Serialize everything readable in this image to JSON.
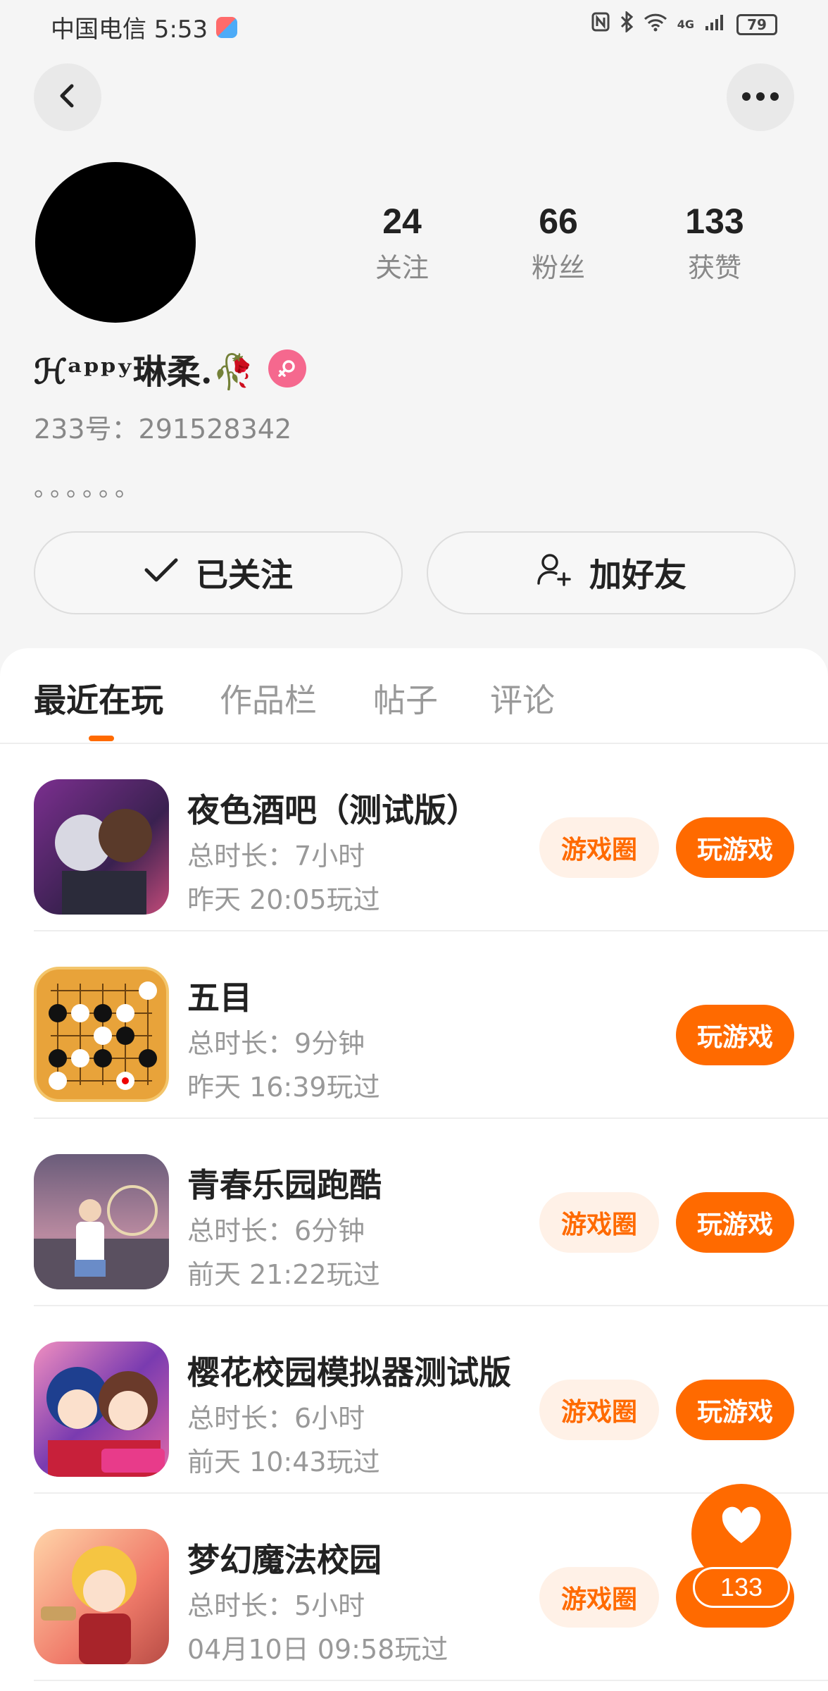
{
  "status_bar": {
    "carrier_time": "中国电信 5:53",
    "network": "4G",
    "battery": "79"
  },
  "profile": {
    "stats": [
      {
        "value": "24",
        "label": "关注"
      },
      {
        "value": "66",
        "label": "粉丝"
      },
      {
        "value": "133",
        "label": "获赞"
      }
    ],
    "nickname": "ℋᵃᵖᵖʸ琳柔.🥀",
    "id_line": "233号：291528342",
    "bio": "。。。。。。",
    "follow_button": "已关注",
    "add_friend_button": "加好友"
  },
  "tabs": [
    "最近在玩",
    "作品栏",
    "帖子",
    "评论"
  ],
  "active_tab": 0,
  "games": [
    {
      "title": "夜色酒吧（测试版）",
      "duration": "总时长：7小时",
      "last_played": "昨天 20:05玩过",
      "circle_label": "游戏圈",
      "play_label": "玩游戏"
    },
    {
      "title": "五目",
      "duration": "总时长：9分钟",
      "last_played": "昨天 16:39玩过",
      "play_label": "玩游戏"
    },
    {
      "title": "青春乐园跑酷",
      "duration": "总时长：6分钟",
      "last_played": "前天 21:22玩过",
      "circle_label": "游戏圈",
      "play_label": "玩游戏"
    },
    {
      "title": "樱花校园模拟器测试版",
      "duration": "总时长：6小时",
      "last_played": "前天 10:43玩过",
      "circle_label": "游戏圈",
      "play_label": "玩游戏"
    },
    {
      "title": "梦幻魔法校园",
      "duration": "总时长：5小时",
      "last_played": "04月10日 09:58玩过",
      "circle_label": "游戏圈",
      "play_label": ""
    }
  ],
  "like_count": "133",
  "icons": {
    "back": "chevron-left-icon",
    "more": "more-dots-icon",
    "follow": "check-icon",
    "add_friend": "user-plus-icon",
    "gender": "female-icon",
    "like": "heart-icon"
  },
  "colors": {
    "accent": "#ff6a00",
    "accent_light": "#fff1e7",
    "gender_badge": "#f5688e"
  }
}
